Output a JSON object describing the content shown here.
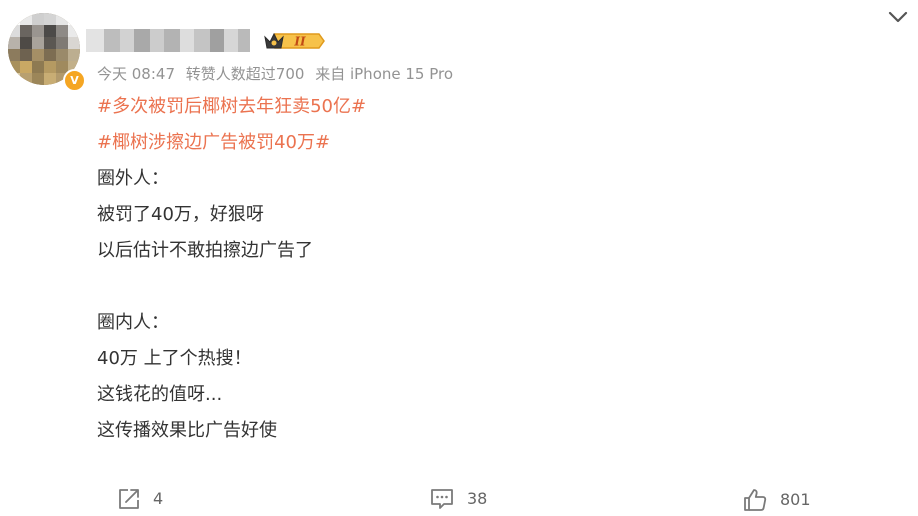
{
  "post": {
    "author": {
      "rank_badge": "II",
      "verified_mark": "V"
    },
    "meta": {
      "time": "今天 08:47",
      "repost_note": "转赞人数超过700",
      "source": "来自 iPhone 15 Pro"
    },
    "content": {
      "hashtags": [
        "#多次被罚后椰树去年狂卖50亿#",
        "#椰树涉擦边广告被罚40万#"
      ],
      "lines": [
        "圈外人：",
        "被罚了40万，好狠呀",
        "以后估计不敢拍擦边广告了",
        "",
        "圈内人：",
        "40万 上了个热搜！",
        "这钱花的值呀...",
        "这传播效果比广告好使"
      ]
    },
    "actions": {
      "repost_count": "4",
      "comment_count": "38",
      "like_count": "801"
    },
    "colors": {
      "hashtag": "#eb7350",
      "meta_text": "#939393",
      "body_text": "#333333",
      "action_text": "#666666",
      "badge_gold": "#f5a623"
    },
    "icons": {
      "more": "chevron-down-icon",
      "repost": "share-arrow-icon",
      "comment": "comment-bubble-icon",
      "like": "thumbs-up-icon"
    }
  }
}
